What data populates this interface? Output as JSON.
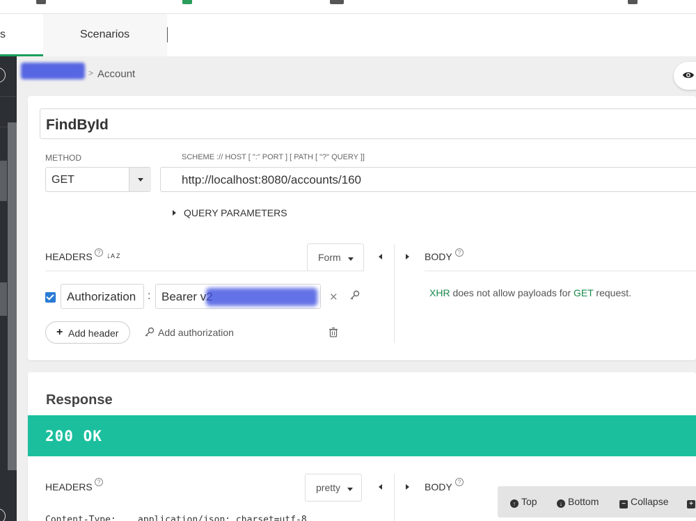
{
  "tabs": {
    "left_label": "s",
    "scenarios_label": "Scenarios"
  },
  "breadcrumb": {
    "separator": ">",
    "current": "Account"
  },
  "request": {
    "name": "FindById",
    "method_label": "METHOD",
    "method_value": "GET",
    "url_label": "SCHEME :// HOST [ \":\" PORT ] [ PATH [ \"?\" QUERY ]]",
    "url_value": "http://localhost:8080/accounts/160",
    "query_params_label": "QUERY PARAMETERS",
    "headers_label": "HEADERS",
    "headers_mode": "Form",
    "body_label": "BODY",
    "header_rows": [
      {
        "key": "Authorization",
        "value": "Bearer v2",
        "enabled": true
      }
    ],
    "add_header_label": "Add header",
    "add_authorization_label": "Add authorization",
    "body_note_prefix": "XHR",
    "body_note_middle": " does not allow payloads for ",
    "body_note_method": "GET",
    "body_note_suffix": " request."
  },
  "response": {
    "title": "Response",
    "status": "200 OK",
    "headers_label": "HEADERS",
    "headers_mode": "pretty",
    "body_label": "BODY",
    "first_header_line": "Content-Type:    application/json; charset=utf-8"
  },
  "float_bar": {
    "top_label": "Top",
    "bottom_label": "Bottom",
    "collapse_label": "Collapse"
  },
  "colors": {
    "accent_green": "#1a9e5c",
    "status_teal": "#1bbf9e",
    "checkbox_blue": "#2a7bd5"
  }
}
